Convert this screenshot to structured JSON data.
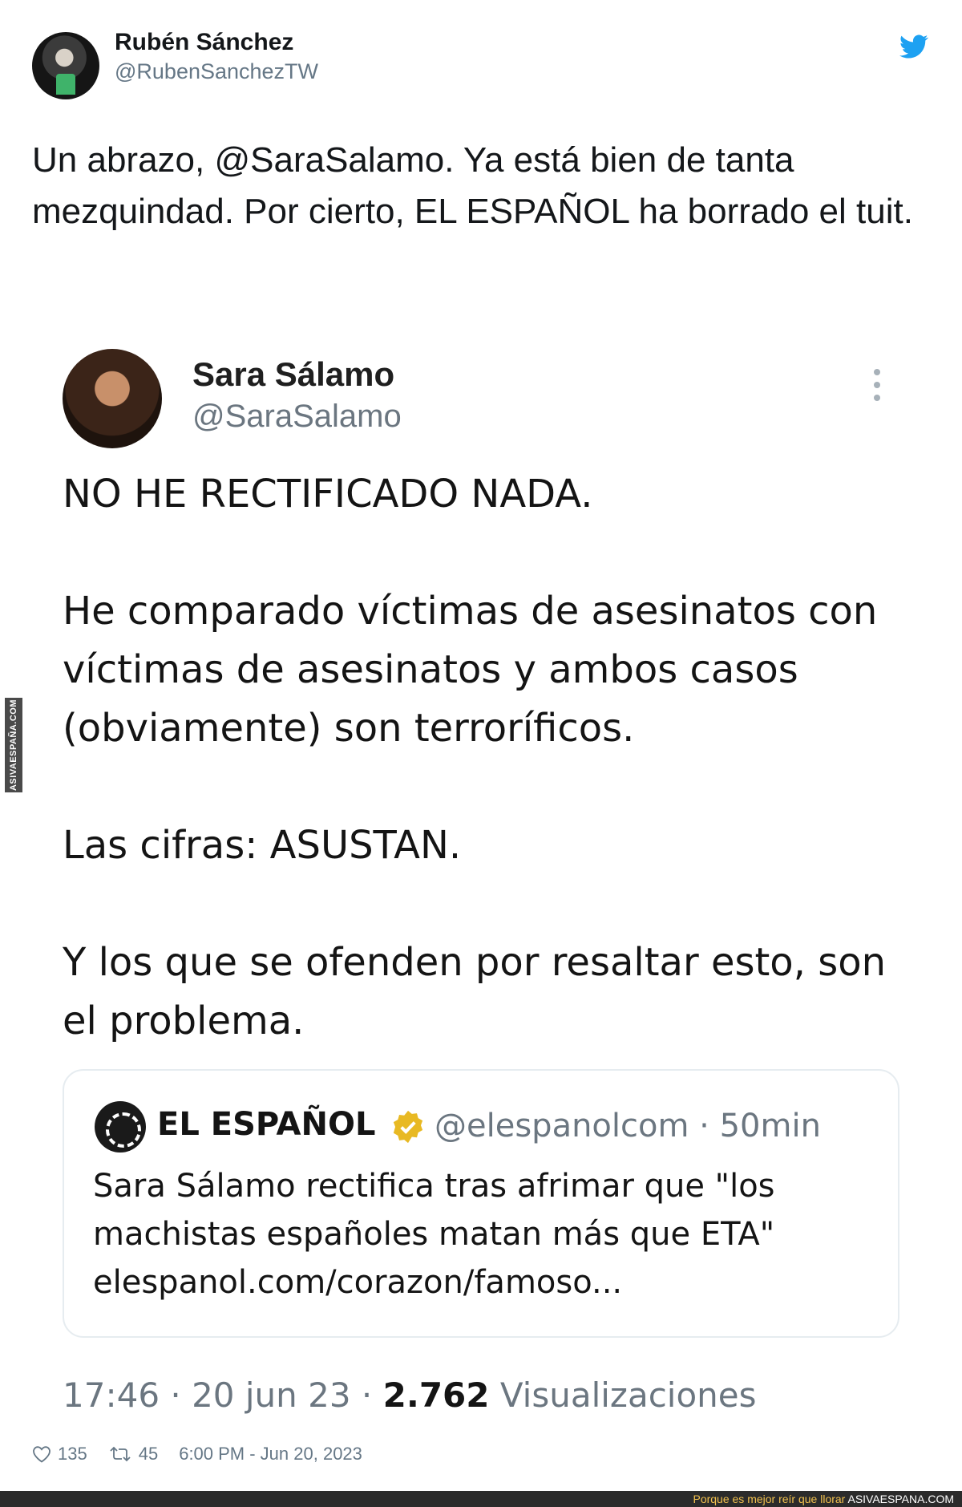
{
  "outer_tweet": {
    "author_name": "Rubén Sánchez",
    "author_handle": "@RubenSanchezTW",
    "text": "Un abrazo, @SaraSalamo. Ya está bien de tanta mezquindad. Por cierto, EL ESPAÑOL ha borrado el tuit.",
    "likes": "135",
    "retweets": "45",
    "timestamp": "6:00 PM - Jun 20, 2023",
    "icon": "twitter-bird-icon",
    "brand_color": "#1da1f2"
  },
  "embedded_tweet": {
    "author_name": "Sara Sálamo",
    "author_handle": "@SaraSalamo",
    "paragraphs": [
      "NO HE RECTIFICADO NADA.",
      "He comparado víctimas de asesinatos con víctimas de asesinatos y ambos casos (obviamente) son terroríficos.",
      "Las cifras: ASUSTAN.",
      "Y los que se ofenden por resaltar esto, son el problema."
    ],
    "quoted": {
      "name": "EL ESPAÑOL",
      "handle_time": "@elespanolcom · 50min",
      "text": "Sara Sálamo rectifica tras afrimar que \"los machistas españoles matan más que ETA\" elespanol.com/corazon/famoso...",
      "verified_color": "#e8b923"
    },
    "meta_prefix": "17:46 · 20 jun 23 ·",
    "views_count": "2.762",
    "views_label": "Visualizaciones"
  },
  "watermark": {
    "side": "ASIVAESPAÑA.COM",
    "tagline": "Porque es mejor reír que llorar",
    "site": "ASIVAESPANA.COM"
  }
}
